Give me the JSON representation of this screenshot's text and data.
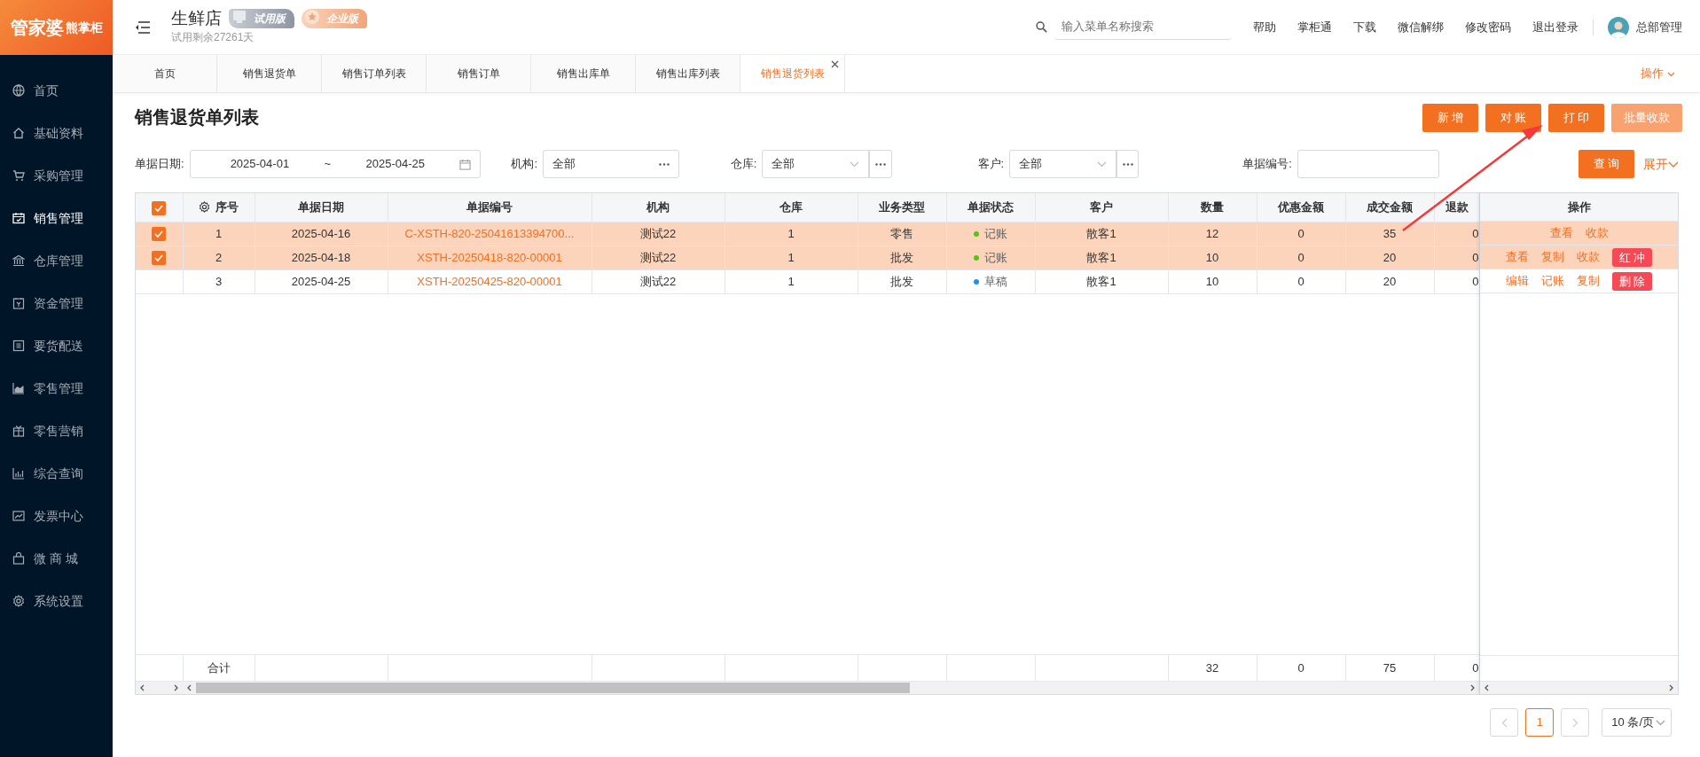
{
  "sidebar": {
    "logo": {
      "brand": "管家婆",
      "sub": "熊掌柜"
    },
    "items": [
      {
        "label": "首页",
        "selected": false
      },
      {
        "label": "基础资料",
        "selected": false
      },
      {
        "label": "采购管理",
        "selected": false
      },
      {
        "label": "销售管理",
        "selected": true
      },
      {
        "label": "仓库管理",
        "selected": false
      },
      {
        "label": "资金管理",
        "selected": false
      },
      {
        "label": "要货配送",
        "selected": false
      },
      {
        "label": "零售管理",
        "selected": false
      },
      {
        "label": "零售营销",
        "selected": false
      },
      {
        "label": "综合查询",
        "selected": false
      },
      {
        "label": "发票中心",
        "selected": false
      },
      {
        "label": "微 商 城",
        "selected": false
      },
      {
        "label": "系统设置",
        "selected": false
      }
    ]
  },
  "header": {
    "store": "生鲜店",
    "badges": [
      {
        "label": "试用版",
        "kind": "trial"
      },
      {
        "label": "企业版",
        "kind": "enterprise"
      }
    ],
    "trial_note": "试用剩余27261天",
    "search": {
      "placeholder": "输入菜单名称搜索"
    },
    "links": [
      "帮助",
      "掌柜通",
      "下载",
      "微信解绑",
      "修改密码",
      "退出登录"
    ],
    "user": "总部管理"
  },
  "tabs": [
    {
      "label": "首页",
      "selected": false,
      "closable": false
    },
    {
      "label": "销售退货单",
      "selected": false,
      "closable": false
    },
    {
      "label": "销售订单列表",
      "selected": false,
      "closable": false
    },
    {
      "label": "销售订单",
      "selected": false,
      "closable": false
    },
    {
      "label": "销售出库单",
      "selected": false,
      "closable": false
    },
    {
      "label": "销售出库列表",
      "selected": false,
      "closable": false
    },
    {
      "label": "销售退货列表",
      "selected": true,
      "closable": true
    }
  ],
  "tab_menu": "操作",
  "page": {
    "title": "销售退货单列表",
    "buttons": [
      {
        "label": "新 增",
        "kind": "primary"
      },
      {
        "label": "对 账",
        "kind": "primary"
      },
      {
        "label": "打 印",
        "kind": "primary"
      },
      {
        "label": "批量收款",
        "kind": "light"
      }
    ]
  },
  "filters": {
    "date": {
      "label": "单据日期:",
      "from": "2025-04-01",
      "separator": "~",
      "to": "2025-04-25"
    },
    "org": {
      "label": "机构:",
      "value": "全部"
    },
    "warehouse": {
      "label": "仓库:",
      "value": "全部"
    },
    "customer": {
      "label": "客户:",
      "value": "全部"
    },
    "doc_no": {
      "label": "单据编号:"
    },
    "query_button": "查 询",
    "expand_link": "展开"
  },
  "table": {
    "all_checked": true,
    "columns": [
      "序号",
      "单据日期",
      "单据编号",
      "机构",
      "仓库",
      "业务类型",
      "单据状态",
      "客户",
      "数量",
      "优惠金额",
      "成交金额",
      "退款",
      "操作"
    ],
    "rows": [
      {
        "selected": true,
        "no": "1",
        "date": "2025-04-16",
        "doc_no": "C-XSTH-820-25041613394700...",
        "org": "测试22",
        "warehouse": "1",
        "type": "零售",
        "status": {
          "label": "记账",
          "color": "#52c41a"
        },
        "customer": "散客1",
        "qty": "12",
        "discount": "0",
        "amount": "35",
        "refund": "0",
        "actions": [
          {
            "label": "查看",
            "kind": "link"
          },
          {
            "label": "收款",
            "kind": "link"
          }
        ]
      },
      {
        "selected": true,
        "no": "2",
        "date": "2025-04-18",
        "doc_no": "XSTH-20250418-820-00001",
        "org": "测试22",
        "warehouse": "1",
        "type": "批发",
        "status": {
          "label": "记账",
          "color": "#52c41a"
        },
        "customer": "散客1",
        "qty": "10",
        "discount": "0",
        "amount": "20",
        "refund": "0",
        "actions": [
          {
            "label": "查看",
            "kind": "link"
          },
          {
            "label": "复制",
            "kind": "link"
          },
          {
            "label": "收款",
            "kind": "link"
          },
          {
            "label": "红 冲",
            "kind": "danger"
          }
        ]
      },
      {
        "selected": false,
        "no": "3",
        "date": "2025-04-25",
        "doc_no": "XSTH-20250425-820-00001",
        "org": "测试22",
        "warehouse": "1",
        "type": "批发",
        "status": {
          "label": "草稿",
          "color": "#1890ff"
        },
        "customer": "散客1",
        "qty": "10",
        "discount": "0",
        "amount": "20",
        "refund": "0",
        "actions": [
          {
            "label": "编辑",
            "kind": "link"
          },
          {
            "label": "记账",
            "kind": "link"
          },
          {
            "label": "复制",
            "kind": "link"
          },
          {
            "label": "删 除",
            "kind": "danger"
          }
        ]
      }
    ],
    "totals": {
      "label": "合计",
      "qty": "32",
      "discount": "0",
      "amount": "75",
      "refund": "0"
    }
  },
  "pagination": {
    "prev_disabled": true,
    "next_disabled": true,
    "pages": [
      {
        "label": "1",
        "selected": true
      }
    ],
    "page_size": "10 条/页"
  }
}
